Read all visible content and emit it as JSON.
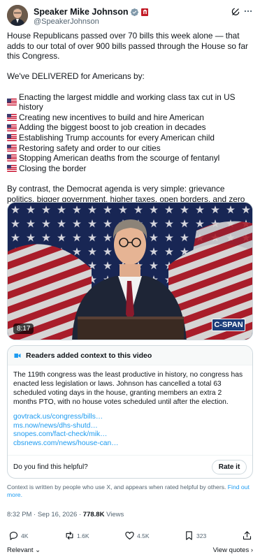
{
  "post": {
    "author_name": "Speaker Mike Johnson",
    "handle": "@SpeakerJohnson",
    "intro": "House Republicans passed over 70 bills this week alone — that adds to our total of over 900 bills passed through the House so far this Congress.",
    "delivered": "We've DELIVERED for Americans by:",
    "list_items": [
      "Enacting the largest middle and working class tax cut in US history",
      "Creating new incentives to build and hire American",
      "Adding the biggest boost to job creation in decades",
      "Establishing Trump accounts for every American child",
      "Restoring safety and order to our cities",
      "Stopping American deaths from the scourge of fentanyl",
      "Closing the border"
    ],
    "closing": "By contrast, the Democrat agenda is very simple: grievance politics, bigger government, higher taxes, open borders, and zero security."
  },
  "video": {
    "duration": "8:17",
    "watermark": "C-SPAN"
  },
  "community_note": {
    "header": "Readers added context to this video",
    "body": "The 119th congress was the least productive in history, no congress has enacted less legislation or laws. Johnson has cancelled a total 63 scheduled voting days in the house, granting members an extra 2 months PTO, with no house votes scheduled until after the election.",
    "links": [
      "govtrack.us/congress/bills…",
      "ms.now/news/dhs-shutd…",
      "snopes.com/fact-check/mik…",
      "cbsnews.com/news/house-can…"
    ],
    "helpful_question": "Do you find this helpful?",
    "rate_label": "Rate it"
  },
  "context_note": {
    "text": "Context is written by people who use X, and appears when rated helpful by others.",
    "learn_more": "Find out more."
  },
  "meta": {
    "timestamp": "8:32 PM · Sep 16, 2026 · ",
    "views_count": "778.8K",
    "views_label": " Views"
  },
  "actions": {
    "replies": "4K",
    "reposts": "1.6K",
    "likes": "4.5K",
    "bookmarks": "323"
  },
  "footer": {
    "sort_label": "Relevant",
    "view_quotes": "View quotes ›"
  },
  "colors": {
    "accent": "#1d9bf0",
    "text": "#0f1419",
    "muted": "#536471",
    "verified": "#829aab",
    "gov_badge": "#c21a26"
  },
  "icons": [
    "grok-icon",
    "more-icon",
    "verified-icon",
    "government-badge-icon",
    "reply-icon",
    "repost-icon",
    "like-icon",
    "bookmark-icon",
    "share-icon",
    "info-icon"
  ]
}
